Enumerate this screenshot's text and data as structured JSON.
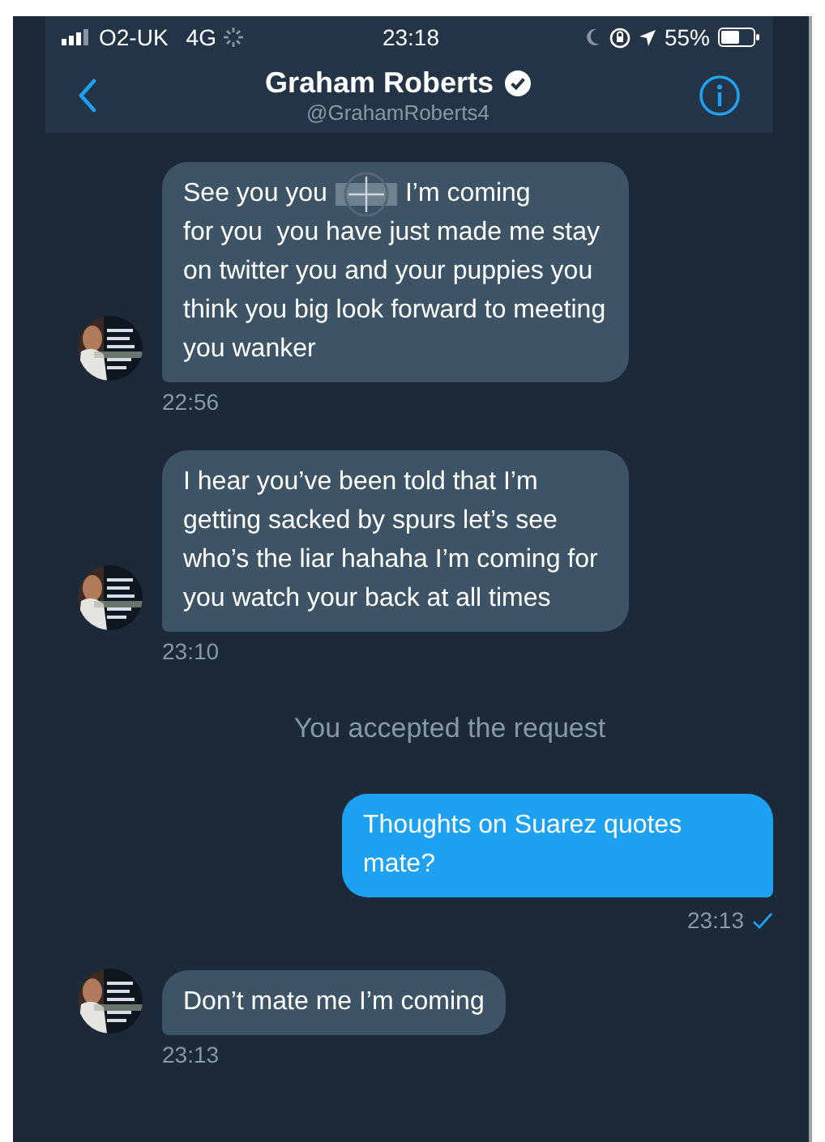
{
  "status_bar": {
    "carrier": "O2-UK",
    "network": "4G",
    "time": "23:18",
    "battery": "55%"
  },
  "header": {
    "name": "Graham Roberts",
    "verified": true,
    "handle": "@GrahamRoberts4"
  },
  "messages": [
    {
      "kind": "received",
      "parts": [
        "See you you",
        "I’m coming",
        "for you  you have just made me stay on twitter you and your puppies you think you big look forward to meeting you wanker"
      ],
      "redacted": true,
      "time": "22:56"
    },
    {
      "kind": "received",
      "parts": [
        "I hear you’ve been told that I’m getting sacked by spurs let’s see who’s the liar hahaha I’m coming for you watch your back at all times"
      ],
      "time": "23:10"
    },
    {
      "kind": "notice",
      "text": "You accepted the request"
    },
    {
      "kind": "sent",
      "parts": [
        "Thoughts on Suarez quotes mate?"
      ],
      "time": "23:13",
      "read": true
    },
    {
      "kind": "received",
      "parts": [
        "Don’t mate me I’m coming"
      ],
      "time": "23:13"
    }
  ]
}
